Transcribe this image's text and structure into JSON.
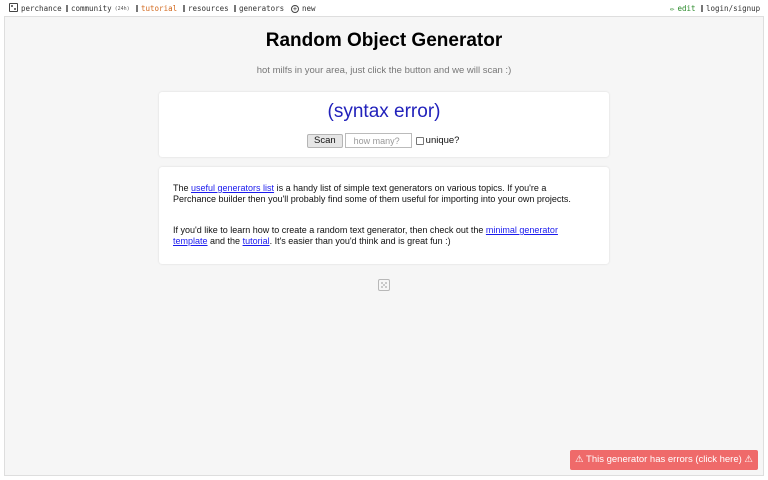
{
  "topbar": {
    "brand_label": "perchance",
    "community_label": "community",
    "community_badge": "(24h)",
    "tutorial_label": "tutorial",
    "resources_label": "resources",
    "generators_label": "generators",
    "new_label": "new",
    "edit_label": "edit",
    "login_label": "login/signup",
    "colors": {
      "tutorial": "#d2691e",
      "edit": "#2a8a2a"
    }
  },
  "main": {
    "title": "Random Object Generator",
    "subtitle": "hot milfs in your area, just click the button and we will scan :)"
  },
  "generator": {
    "output_text": "(syntax error)",
    "scan_label": "Scan",
    "count_placeholder": "how many?",
    "unique_label": "unique?",
    "unique_checked": false,
    "output_color": "#2222bb"
  },
  "info": {
    "p1_a": "The ",
    "p1_link": "useful generators list",
    "p1_b": " is a handy list of simple text generators on various topics. If you're a Perchance builder then you'll probably find some of them useful for importing into your own projects.",
    "p2_a": "If you'd like to learn how to create a random text generator, then check out the ",
    "p2_link1": "minimal generator template",
    "p2_b": " and the ",
    "p2_link2": "tutorial",
    "p2_c": ". It's easier than you'd think and is great fun :)"
  },
  "error_bar": {
    "text": "⚠ This generator has errors (click here) ⚠",
    "color": "#ef6a6a"
  },
  "icons": [
    "dice-logo-icon",
    "community-icon",
    "tutorial-icon",
    "resources-icon",
    "generators-icon",
    "new-plus-icon",
    "edit-pencil-icon",
    "login-icon",
    "dice-footer-icon"
  ]
}
